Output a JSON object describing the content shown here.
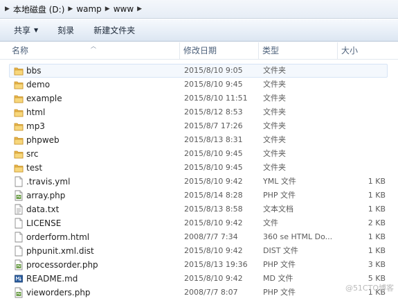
{
  "address_bar": {
    "crumbs": [
      "本地磁盘 (D:)",
      "wamp",
      "www"
    ]
  },
  "toolbar": {
    "share_label": "共享",
    "burn_label": "刻录",
    "new_folder_label": "新建文件夹"
  },
  "columns": {
    "name": "名称",
    "date": "修改日期",
    "type": "类型",
    "size": "大小"
  },
  "files": [
    {
      "name": "bbs",
      "date": "2015/8/10 9:05",
      "type": "文件夹",
      "size": "",
      "icon": "folder-icon"
    },
    {
      "name": "demo",
      "date": "2015/8/10 9:45",
      "type": "文件夹",
      "size": "",
      "icon": "folder-icon"
    },
    {
      "name": "example",
      "date": "2015/8/10 11:51",
      "type": "文件夹",
      "size": "",
      "icon": "folder-icon"
    },
    {
      "name": "html",
      "date": "2015/8/12 8:53",
      "type": "文件夹",
      "size": "",
      "icon": "folder-icon"
    },
    {
      "name": "mp3",
      "date": "2015/8/7 17:26",
      "type": "文件夹",
      "size": "",
      "icon": "folder-icon"
    },
    {
      "name": "phpweb",
      "date": "2015/8/13 8:31",
      "type": "文件夹",
      "size": "",
      "icon": "folder-icon"
    },
    {
      "name": "src",
      "date": "2015/8/10 9:45",
      "type": "文件夹",
      "size": "",
      "icon": "folder-icon"
    },
    {
      "name": "test",
      "date": "2015/8/10 9:45",
      "type": "文件夹",
      "size": "",
      "icon": "folder-icon"
    },
    {
      "name": ".travis.yml",
      "date": "2015/8/10 9:42",
      "type": "YML 文件",
      "size": "1 KB",
      "icon": "document-icon"
    },
    {
      "name": "array.php",
      "date": "2015/8/14 8:28",
      "type": "PHP 文件",
      "size": "1 KB",
      "icon": "php-file-icon"
    },
    {
      "name": "data.txt",
      "date": "2015/8/13 8:58",
      "type": "文本文档",
      "size": "1 KB",
      "icon": "text-file-icon"
    },
    {
      "name": "LICENSE",
      "date": "2015/8/10 9:42",
      "type": "文件",
      "size": "2 KB",
      "icon": "document-icon"
    },
    {
      "name": "orderform.html",
      "date": "2008/7/7 7:34",
      "type": "360 se HTML Do...",
      "size": "1 KB",
      "icon": "document-icon"
    },
    {
      "name": "phpunit.xml.dist",
      "date": "2015/8/10 9:42",
      "type": "DIST 文件",
      "size": "1 KB",
      "icon": "document-icon"
    },
    {
      "name": "processorder.php",
      "date": "2015/8/13 19:36",
      "type": "PHP 文件",
      "size": "3 KB",
      "icon": "php-file-icon"
    },
    {
      "name": "README.md",
      "date": "2015/8/10 9:42",
      "type": "MD 文件",
      "size": "5 KB",
      "icon": "markdown-file-icon"
    },
    {
      "name": "vieworders.php",
      "date": "2008/7/7 8:07",
      "type": "PHP 文件",
      "size": "1 KB",
      "icon": "php-file-icon"
    }
  ],
  "watermark": "@51CTO博客"
}
